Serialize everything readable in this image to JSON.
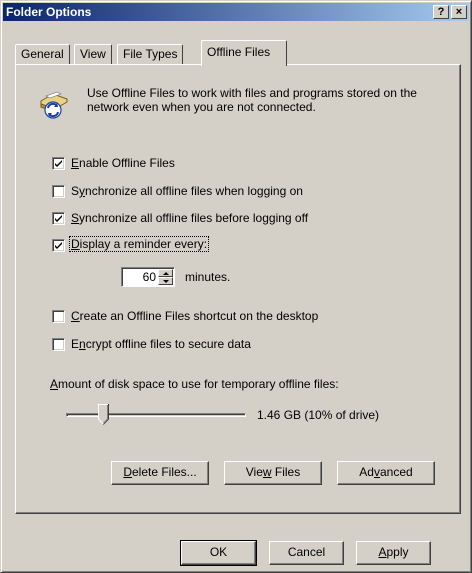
{
  "window": {
    "title": "Folder Options",
    "help_glyph": "?",
    "close_glyph": "×"
  },
  "tabs": [
    {
      "label": "General"
    },
    {
      "label": "View"
    },
    {
      "label": "File Types"
    },
    {
      "label": "Offline Files"
    }
  ],
  "active_tab": "Offline Files",
  "intro": {
    "icon": "offline-files-sync-icon",
    "line1": "Use Offline Files to work with files and programs stored on the",
    "line2": "network even when you are not connected."
  },
  "options": [
    {
      "pre": "",
      "key": "E",
      "post": "nable Offline Files",
      "checked": true
    },
    {
      "pre": "S",
      "key": "y",
      "post": "nchronize all offline files when logging on",
      "checked": false
    },
    {
      "pre": "",
      "key": "S",
      "post": "ynchronize all offline files before logging off",
      "checked": true
    },
    {
      "pre": "",
      "key": "D",
      "post": "isplay a reminder every:",
      "checked": true,
      "focused": true
    }
  ],
  "reminder": {
    "value": "60",
    "unit": "minutes."
  },
  "options2": [
    {
      "pre": "",
      "key": "C",
      "post": "reate an Offline Files shortcut on the desktop",
      "checked": false
    },
    {
      "pre": "E",
      "key": "n",
      "post": "crypt offline files to secure data",
      "checked": false
    }
  ],
  "disk": {
    "label_pre": "",
    "label_key": "A",
    "label_post": "mount of disk space to use for temporary offline files:",
    "slider_fraction": 0.1,
    "value_text": "1.46 GB (10% of drive)"
  },
  "actions": {
    "delete_pre": "",
    "delete_key": "D",
    "delete_post": "elete Files...",
    "view_pre": "Vie",
    "view_key": "w",
    "view_post": " Files",
    "advanced_pre": "Ad",
    "advanced_key": "v",
    "advanced_post": "anced"
  },
  "footer": {
    "ok": "OK",
    "cancel": "Cancel",
    "apply_pre": "",
    "apply_key": "A",
    "apply_post": "pply"
  },
  "colors": {
    "titlebar_start": "#0a246a",
    "titlebar_end": "#a6caf0",
    "face": "#d4d0c8"
  }
}
